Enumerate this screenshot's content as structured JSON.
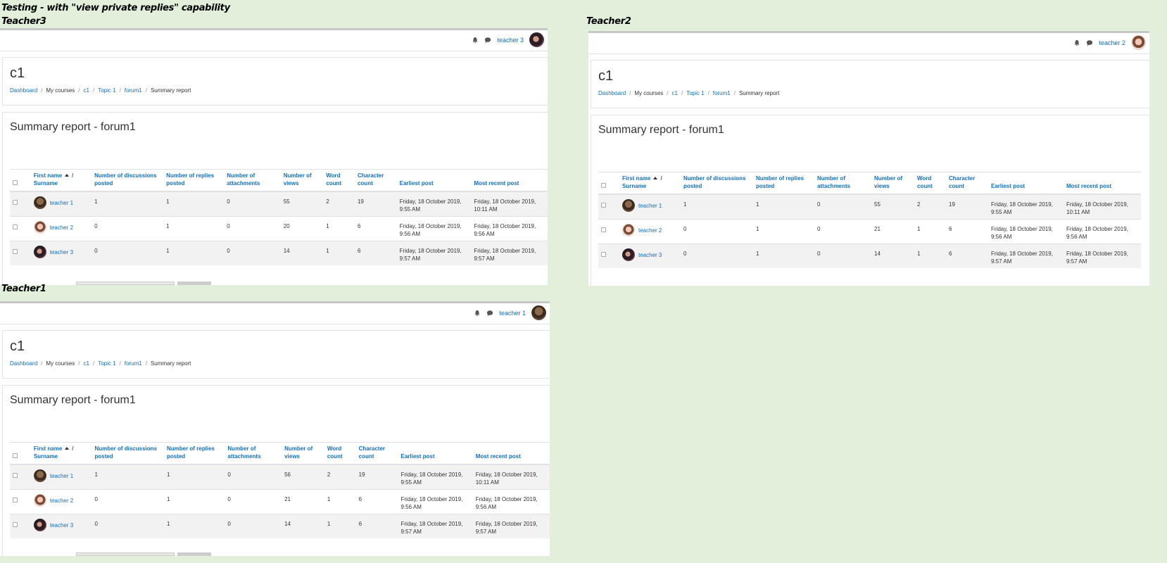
{
  "title": "Testing - with \"view private replies\" capability",
  "panels": [
    {
      "label": "Teacher3",
      "user": "teacher 3",
      "course": "c1",
      "breadcrumb": [
        "Dashboard",
        "My courses",
        "c1",
        "Topic 1",
        "forum1",
        "Summary report"
      ],
      "report_title": "Summary report - forum1",
      "columns": [
        "First name",
        "Surname",
        "Number of discussions posted",
        "Number of replies posted",
        "Number of attachments",
        "Number of views",
        "Word count",
        "Character count",
        "Earliest post",
        "Most recent post"
      ],
      "rows": [
        {
          "name": "teacher 1",
          "discussions": "1",
          "replies": "1",
          "attachments": "0",
          "views": "55",
          "words": "2",
          "chars": "19",
          "earliest": "Friday, 18 October 2019, 9:55 AM",
          "recent": "Friday, 18 October 2019, 10:11 AM"
        },
        {
          "name": "teacher 2",
          "discussions": "0",
          "replies": "1",
          "attachments": "0",
          "views": "20",
          "words": "1",
          "chars": "6",
          "earliest": "Friday, 18 October 2019, 9:56 AM",
          "recent": "Friday, 18 October 2019, 9:56 AM"
        },
        {
          "name": "teacher 3",
          "discussions": "0",
          "replies": "1",
          "attachments": "0",
          "views": "14",
          "words": "1",
          "chars": "6",
          "earliest": "Friday, 18 October 2019, 9:57 AM",
          "recent": "Friday, 18 October 2019, 9:57 AM"
        }
      ]
    },
    {
      "label": "Teacher2",
      "user": "teacher 2",
      "course": "c1",
      "breadcrumb": [
        "Dashboard",
        "My courses",
        "c1",
        "Topic 1",
        "forum1",
        "Summary report"
      ],
      "report_title": "Summary report - forum1",
      "columns": [
        "First name",
        "Surname",
        "Number of discussions posted",
        "Number of replies posted",
        "Number of attachments",
        "Number of views",
        "Word count",
        "Character count",
        "Earliest post",
        "Most recent post"
      ],
      "rows": [
        {
          "name": "teacher 1",
          "discussions": "1",
          "replies": "1",
          "attachments": "0",
          "views": "55",
          "words": "2",
          "chars": "19",
          "earliest": "Friday, 18 October 2019, 9:55 AM",
          "recent": "Friday, 18 October 2019, 10:11 AM"
        },
        {
          "name": "teacher 2",
          "discussions": "0",
          "replies": "1",
          "attachments": "0",
          "views": "21",
          "words": "1",
          "chars": "6",
          "earliest": "Friday, 18 October 2019, 9:56 AM",
          "recent": "Friday, 18 October 2019, 9:56 AM"
        },
        {
          "name": "teacher 3",
          "discussions": "0",
          "replies": "1",
          "attachments": "0",
          "views": "14",
          "words": "1",
          "chars": "6",
          "earliest": "Friday, 18 October 2019, 9:57 AM",
          "recent": "Friday, 18 October 2019, 9:57 AM"
        }
      ]
    },
    {
      "label": "Teacher1",
      "user": "teacher 1",
      "course": "c1",
      "breadcrumb": [
        "Dashboard",
        "My courses",
        "c1",
        "Topic 1",
        "forum1",
        "Summary report"
      ],
      "report_title": "Summary report - forum1",
      "columns": [
        "First name",
        "Surname",
        "Number of discussions posted",
        "Number of replies posted",
        "Number of attachments",
        "Number of views",
        "Word count",
        "Character count",
        "Earliest post",
        "Most recent post"
      ],
      "rows": [
        {
          "name": "teacher 1",
          "discussions": "1",
          "replies": "1",
          "attachments": "0",
          "views": "56",
          "words": "2",
          "chars": "19",
          "earliest": "Friday, 18 October 2019, 9:55 AM",
          "recent": "Friday, 18 October 2019, 10:11 AM"
        },
        {
          "name": "teacher 2",
          "discussions": "0",
          "replies": "1",
          "attachments": "0",
          "views": "21",
          "words": "1",
          "chars": "6",
          "earliest": "Friday, 18 October 2019, 9:56 AM",
          "recent": "Friday, 18 October 2019, 9:56 AM"
        },
        {
          "name": "teacher 3",
          "discussions": "0",
          "replies": "1",
          "attachments": "0",
          "views": "14",
          "words": "1",
          "chars": "6",
          "earliest": "Friday, 18 October 2019, 9:57 AM",
          "recent": "Friday, 18 October 2019, 9:57 AM"
        }
      ]
    }
  ]
}
